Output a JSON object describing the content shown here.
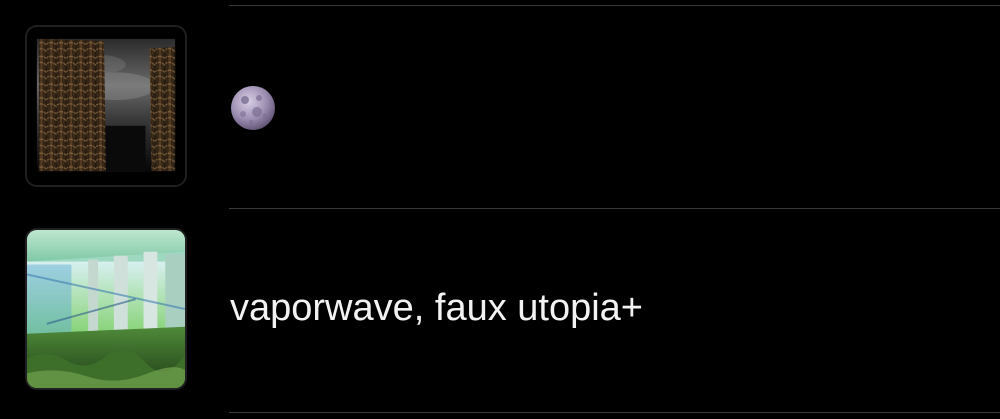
{
  "playlists": [
    {
      "artwork_icon": "dark-forest-artwork",
      "title_icon": "full-moon-emoji",
      "title": ""
    },
    {
      "artwork_icon": "green-hallway-artwork",
      "title": "vaporwave, faux utopia+"
    }
  ],
  "colors": {
    "background": "#000000",
    "divider": "#3a3a3c",
    "title_text": "#f2f2f2"
  }
}
